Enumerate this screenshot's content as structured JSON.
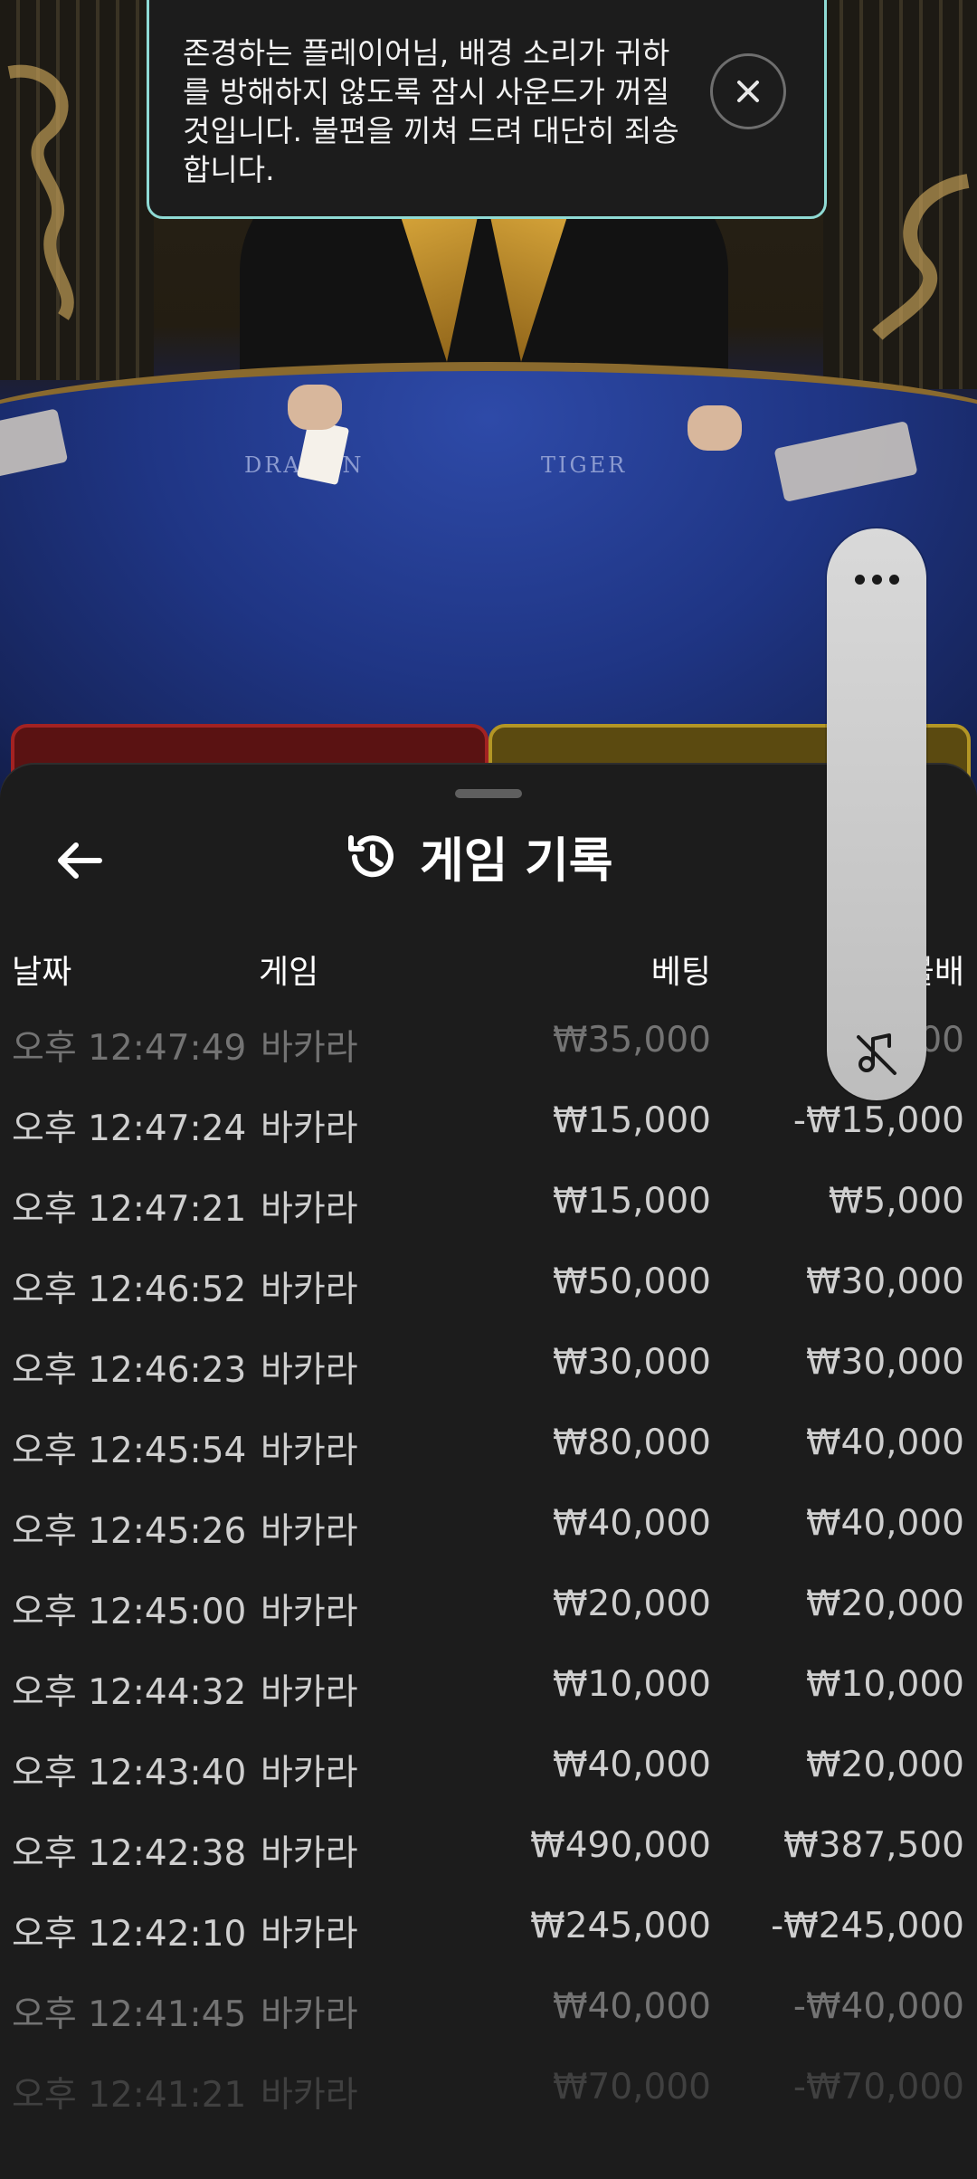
{
  "video": {
    "table_left_label": "DRAGON",
    "table_right_label": "TIGER"
  },
  "toast": {
    "message": "존경하는 플레이어님, 배경 소리가 귀하를 방해하지 않도록 잠시 사운드가 꺼질 것입니다. 불편을 끼쳐 드려 대단히 죄송합니다.",
    "close_icon": "close-icon"
  },
  "sheet": {
    "title": "게임 기록",
    "title_icon": "history-icon",
    "back_icon": "arrow-left-icon",
    "columns": {
      "date": "날짜",
      "game": "게임",
      "bet": "베팅",
      "payout": "지불배"
    },
    "rows": [
      {
        "time": "오후 12:47:49",
        "game": "바카라",
        "bet": "₩35,000",
        "payout": "₩0,000"
      },
      {
        "time": "오후 12:47:24",
        "game": "바카라",
        "bet": "₩15,000",
        "payout": "-₩15,000"
      },
      {
        "time": "오후 12:47:21",
        "game": "바카라",
        "bet": "₩15,000",
        "payout": "₩5,000"
      },
      {
        "time": "오후 12:46:52",
        "game": "바카라",
        "bet": "₩50,000",
        "payout": "₩30,000"
      },
      {
        "time": "오후 12:46:23",
        "game": "바카라",
        "bet": "₩30,000",
        "payout": "₩30,000"
      },
      {
        "time": "오후 12:45:54",
        "game": "바카라",
        "bet": "₩80,000",
        "payout": "₩40,000"
      },
      {
        "time": "오후 12:45:26",
        "game": "바카라",
        "bet": "₩40,000",
        "payout": "₩40,000"
      },
      {
        "time": "오후 12:45:00",
        "game": "바카라",
        "bet": "₩20,000",
        "payout": "₩20,000"
      },
      {
        "time": "오후 12:44:32",
        "game": "바카라",
        "bet": "₩10,000",
        "payout": "₩10,000"
      },
      {
        "time": "오후 12:43:40",
        "game": "바카라",
        "bet": "₩40,000",
        "payout": "₩20,000"
      },
      {
        "time": "오후 12:42:38",
        "game": "바카라",
        "bet": "₩490,000",
        "payout": "₩387,500"
      },
      {
        "time": "오후 12:42:10",
        "game": "바카라",
        "bet": "₩245,000",
        "payout": "-₩245,000"
      },
      {
        "time": "오후 12:41:45",
        "game": "바카라",
        "bet": "₩40,000",
        "payout": "-₩40,000"
      },
      {
        "time": "오후 12:41:21",
        "game": "바카라",
        "bet": "₩70,000",
        "payout": "-₩70,000"
      }
    ]
  },
  "float_menu": {
    "more_icon": "more-horizontal-icon",
    "mute_icon": "sound-off-icon"
  }
}
